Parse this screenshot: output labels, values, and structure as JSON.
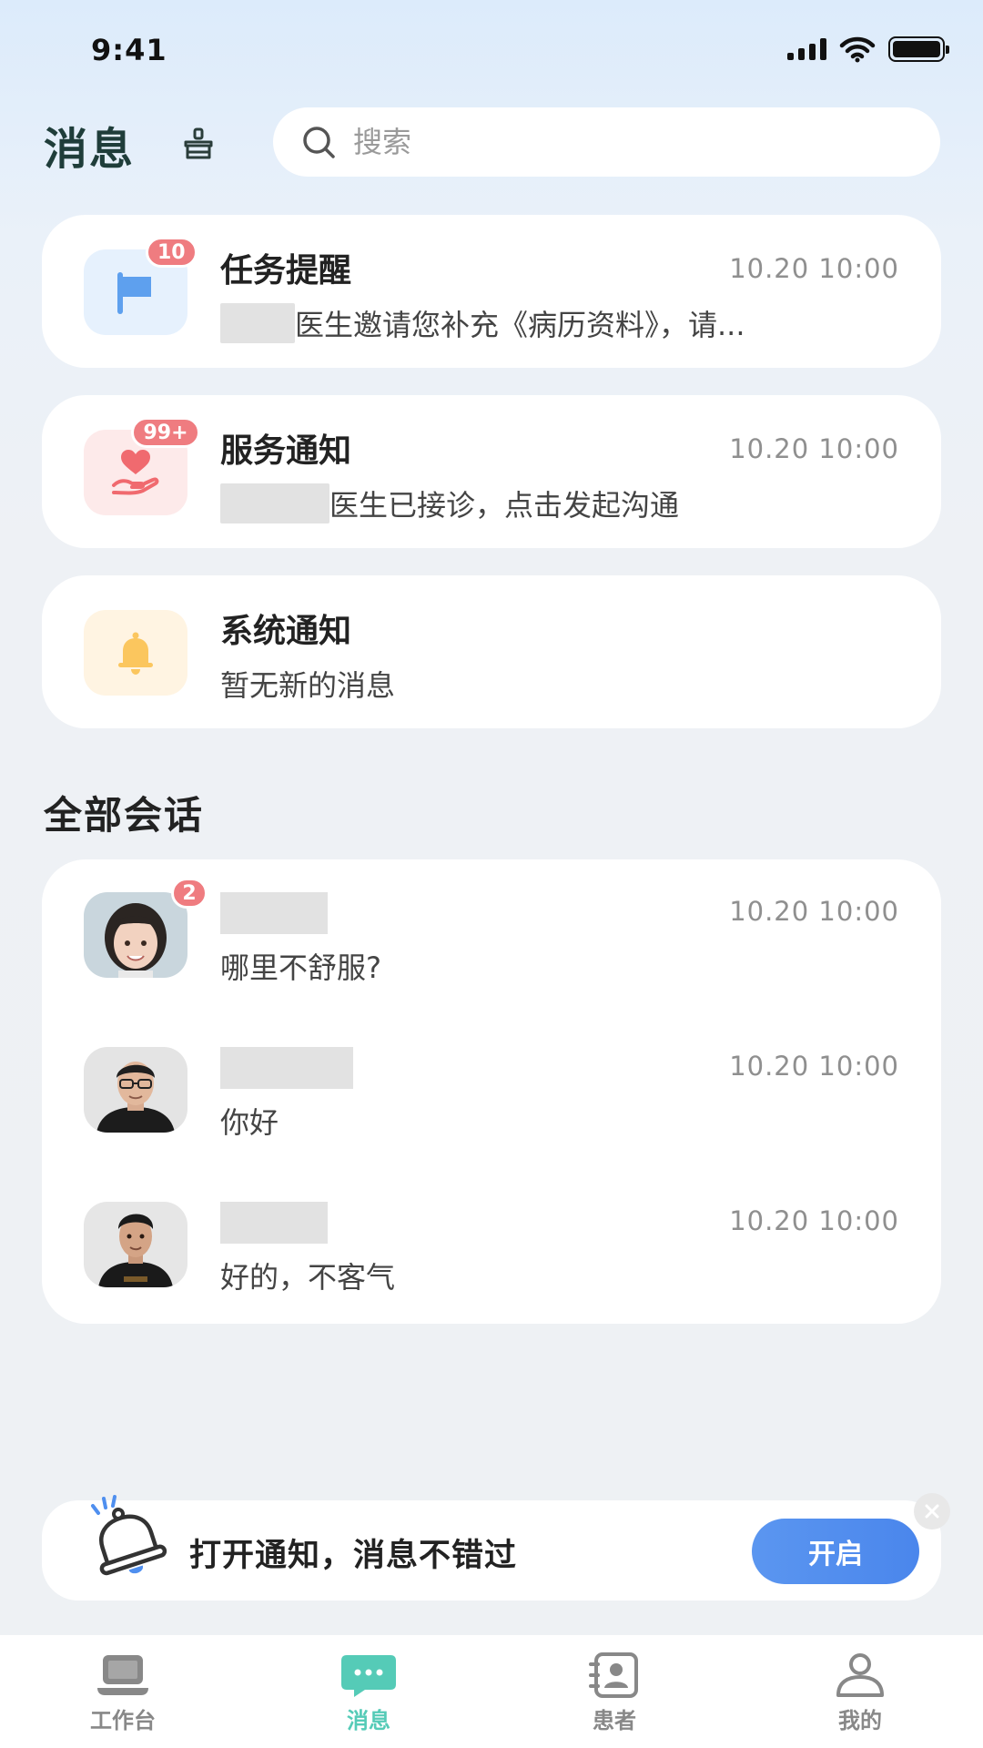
{
  "status_bar": {
    "time": "9:41"
  },
  "header": {
    "title": "消息",
    "search_placeholder": "搜索"
  },
  "notifications": [
    {
      "title": "任务提醒",
      "time": "10.20 10:00",
      "badge": "10",
      "message": "医生邀请您补充《病历资料》，请...",
      "icon": "flag-icon",
      "icon_bg": "#e6f1fd",
      "icon_color": "#5ea0ee"
    },
    {
      "title": "服务通知",
      "time": "10.20 10:00",
      "badge": "99+",
      "message": "医生已接诊，点击发起沟通",
      "icon": "heart-hand-icon",
      "icon_bg": "#fdeaea",
      "icon_color": "#f06a6f"
    },
    {
      "title": "系统通知",
      "time": "",
      "badge": "",
      "message": "暂无新的消息",
      "icon": "bell-icon",
      "icon_bg": "#fff4e2",
      "icon_color": "#fbc65e"
    }
  ],
  "conversations_section": {
    "title": "全部会话"
  },
  "conversations": [
    {
      "time": "10.20 10:00",
      "message": "哪里不舒服?",
      "badge": "2",
      "avatar": "child-avatar"
    },
    {
      "time": "10.20 10:00",
      "message": "你好",
      "badge": "",
      "avatar": "man-glasses-avatar"
    },
    {
      "time": "10.20 10:00",
      "message": "好的，不客气",
      "badge": "",
      "avatar": "man-avatar"
    }
  ],
  "notify_banner": {
    "text": "打开通知，消息不错过",
    "button": "开启"
  },
  "tabbar": [
    {
      "label": "工作台",
      "icon": "laptop-icon",
      "active": false
    },
    {
      "label": "消息",
      "icon": "chat-icon",
      "active": true
    },
    {
      "label": "患者",
      "icon": "contacts-icon",
      "active": false
    },
    {
      "label": "我的",
      "icon": "user-icon",
      "active": false
    }
  ],
  "colors": {
    "accent": "#55cbb7",
    "badge": "#ef7c80",
    "button": "#4a86ec"
  }
}
